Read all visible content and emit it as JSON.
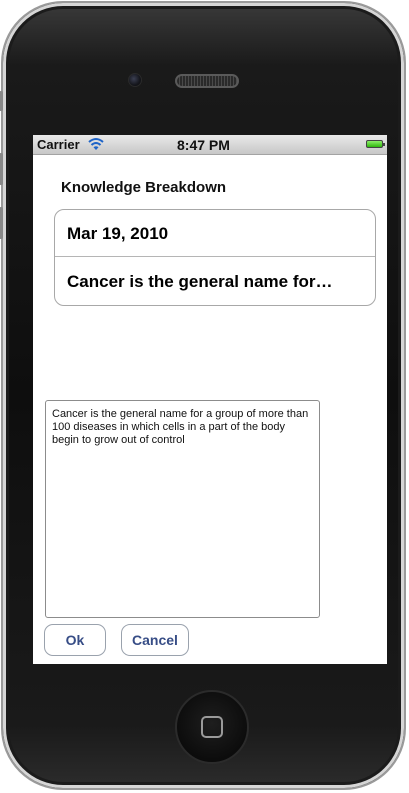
{
  "statusbar": {
    "carrier": "Carrier",
    "time": "8:47 PM",
    "icons": [
      "wifi-icon",
      "battery-icon"
    ]
  },
  "header": {
    "title": "Knowledge Breakdown"
  },
  "table": {
    "rows": [
      {
        "label": "Mar 19, 2010"
      },
      {
        "label": "Cancer is the general name for…"
      }
    ]
  },
  "textview": {
    "value": "Cancer is the general name for a group of more than 100 diseases in which cells  in a part of the body begin to grow out of control"
  },
  "buttons": {
    "ok_label": "Ok",
    "cancel_label": "Cancel"
  },
  "colors": {
    "button_text": "#374d86",
    "battery": "#2fb70d",
    "device_body": "#0e0e0e"
  }
}
